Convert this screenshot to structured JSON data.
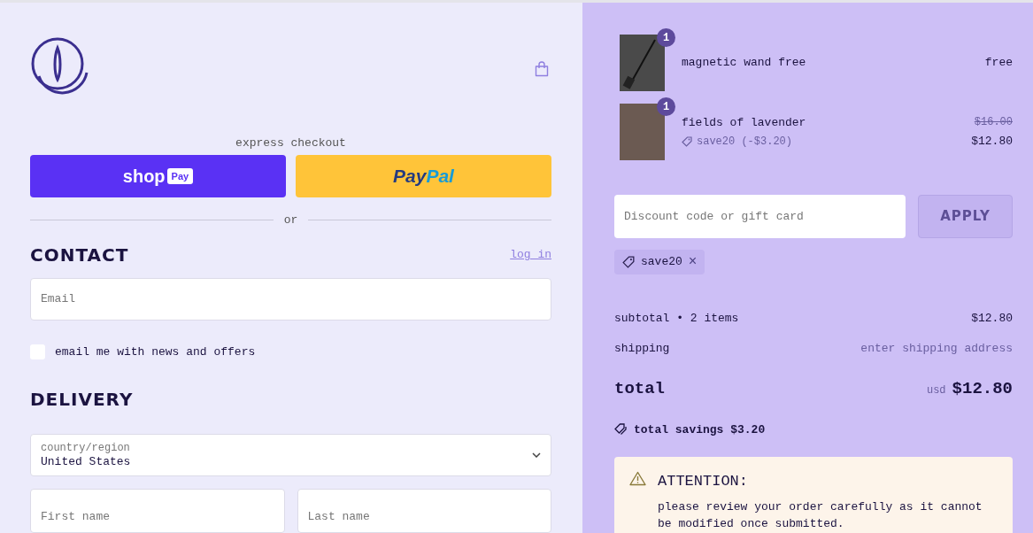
{
  "express_checkout": {
    "label": "express checkout",
    "buttons": [
      {
        "kind": "shop_pay",
        "text": "shop",
        "badge": "Pay"
      },
      {
        "kind": "paypal",
        "text": "Pay",
        "text_2": "Pal"
      }
    ],
    "divider": "or"
  },
  "contact": {
    "heading": "CONTACT",
    "login_link": "log in",
    "email": {
      "placeholder": "Email"
    },
    "newsletter": {
      "label": "email me with news and offers",
      "checked": false
    }
  },
  "delivery": {
    "heading": "DELIVERY",
    "country": {
      "label": "country/region",
      "value": "United States"
    },
    "first_name": {
      "placeholder": "First name"
    },
    "last_name": {
      "placeholder": "Last name"
    }
  },
  "cart": {
    "items": [
      {
        "name": "magnetic wand free",
        "quantity": "1",
        "price": "free",
        "kind": "wand"
      },
      {
        "name": "fields of lavender",
        "quantity": "1",
        "discount": "save20 (-$3.20)",
        "original_price": "$16.00",
        "price": "$12.80",
        "kind": "nails"
      }
    ]
  },
  "discount": {
    "placeholder": "Discount code or gift card",
    "button": "APPLY",
    "applied": [
      {
        "code": "save20",
        "remove": "×"
      }
    ]
  },
  "summary": {
    "rows": [
      {
        "label": "subtotal • 2 items",
        "value": "$12.80",
        "muted": false
      },
      {
        "label": "shipping",
        "value": "enter shipping address",
        "muted": true
      }
    ],
    "total": {
      "label": "total",
      "currency": "usd",
      "amount": "$12.80"
    },
    "savings": "total savings $3.20"
  },
  "attention": {
    "title": "ATTENTION:",
    "body": "please review your order carefully as it cannot be modified once submitted."
  }
}
